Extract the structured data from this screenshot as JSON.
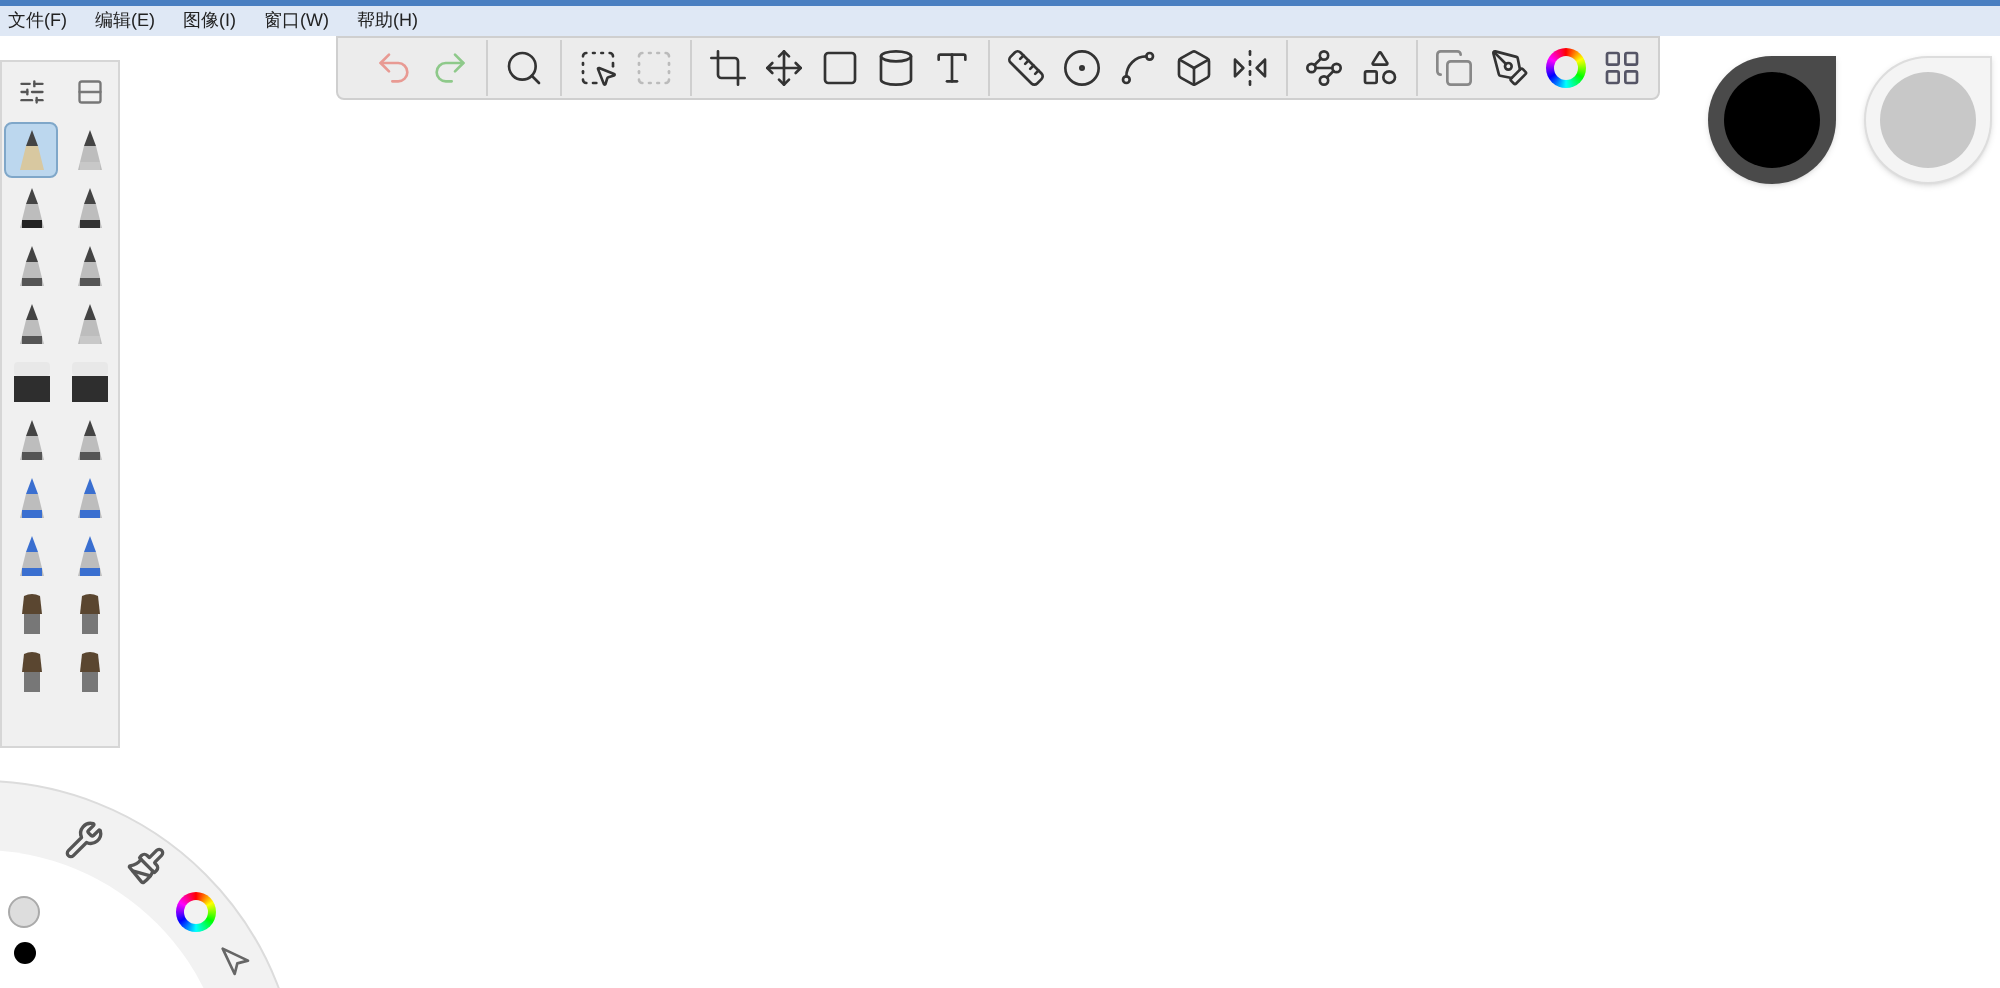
{
  "menu": [
    "文件(F)",
    "编辑(E)",
    "图像(I)",
    "窗口(W)",
    "帮助(H)"
  ],
  "brushes": [
    {
      "kind": "pencil",
      "selected": true
    },
    {
      "kind": "airbrush",
      "selected": false
    },
    {
      "kind": "marker",
      "selected": false
    },
    {
      "kind": "chisel",
      "selected": false
    },
    {
      "kind": "pen",
      "selected": false
    },
    {
      "kind": "pen",
      "selected": false
    },
    {
      "kind": "pen",
      "selected": false
    },
    {
      "kind": "airbrush",
      "selected": false
    },
    {
      "kind": "eraser",
      "selected": false
    },
    {
      "kind": "eraser",
      "selected": false
    },
    {
      "kind": "pen",
      "selected": false
    },
    {
      "kind": "pen",
      "selected": false
    },
    {
      "kind": "blue",
      "selected": false
    },
    {
      "kind": "blue",
      "selected": false
    },
    {
      "kind": "blue",
      "selected": false
    },
    {
      "kind": "blue",
      "selected": false
    },
    {
      "kind": "paintbrush",
      "selected": false
    },
    {
      "kind": "paintbrush",
      "selected": false
    },
    {
      "kind": "paintbrush",
      "selected": false
    },
    {
      "kind": "paintbrush",
      "selected": false
    }
  ],
  "color_pucks": [
    {
      "color": "#000000"
    },
    {
      "color": "#c8c8c8"
    }
  ]
}
